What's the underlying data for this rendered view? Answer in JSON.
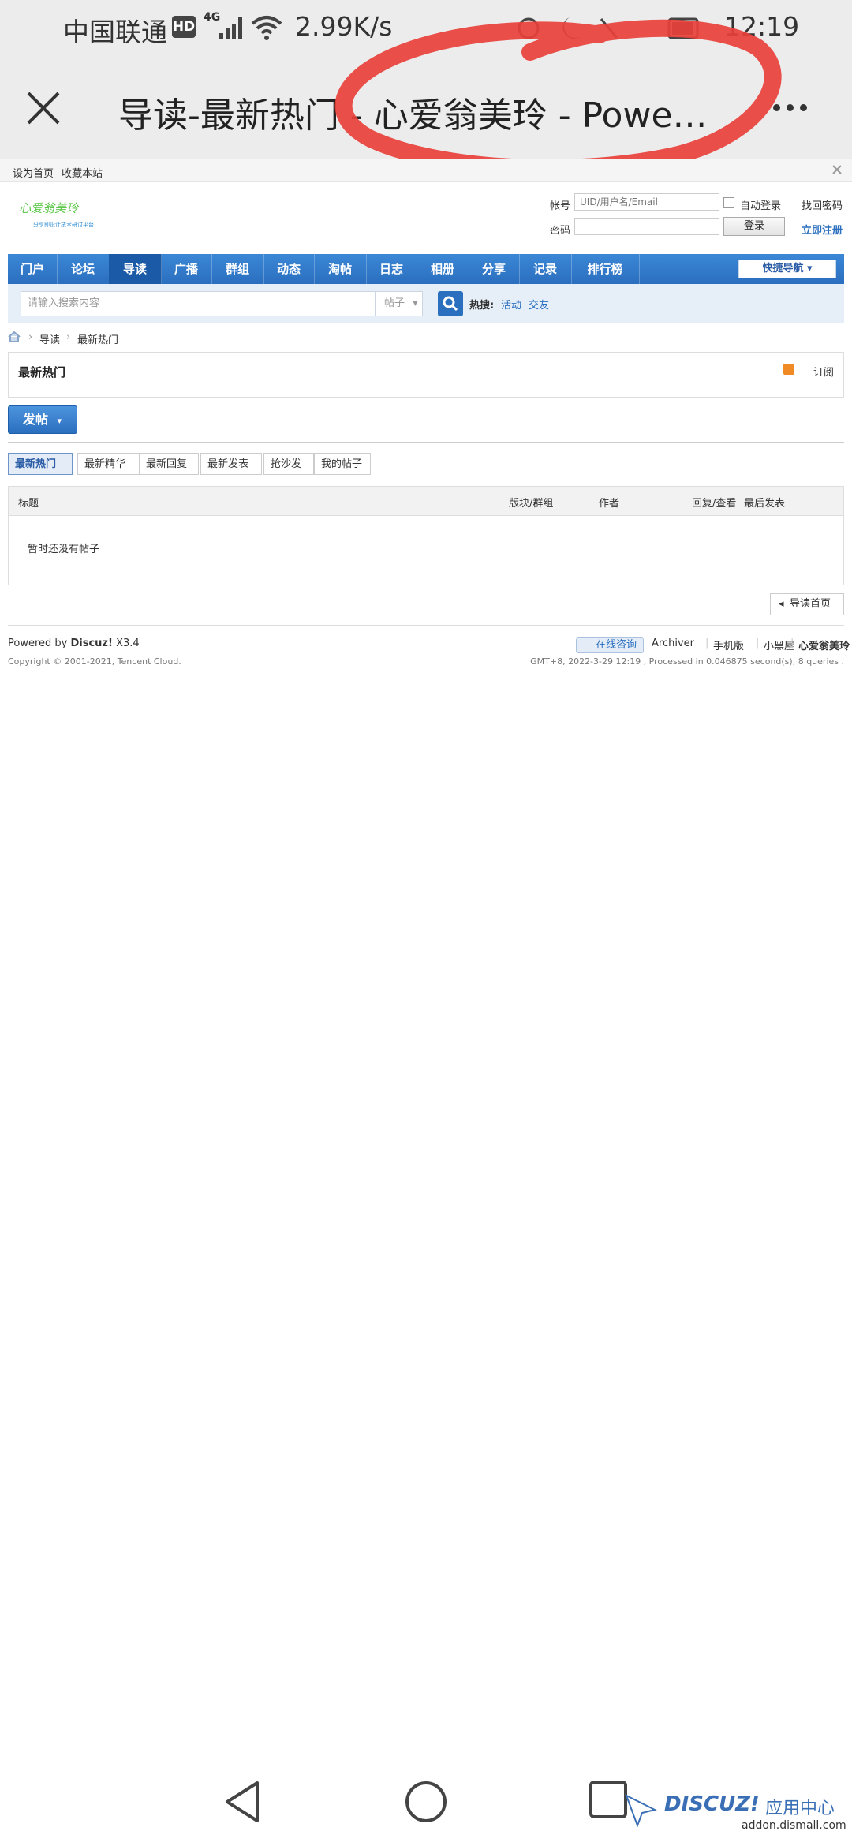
{
  "status_bar": {
    "carrier": "中国联通",
    "hd": "HD",
    "network": "4G",
    "speed": "2.99K/s",
    "time": "12:19"
  },
  "browser": {
    "title": "导读-最新热门 - 心爱翁美玲 - Powered by Discuz!"
  },
  "top_links": [
    "设为首页",
    "收藏本站"
  ],
  "header": {
    "logo_text": "心爱翁美玲",
    "logo_subtext": "分享即设计技术研讨平台",
    "login": {
      "account_label": "帐号",
      "account_placeholder": "UID/用户名/Email",
      "auto_login": "自动登录",
      "find_password": "找回密码",
      "password_label": "密码",
      "login_button": "登录",
      "register": "立即注册"
    }
  },
  "nav": {
    "items": [
      "门户",
      "论坛",
      "导读",
      "广播",
      "群组",
      "动态",
      "淘帖",
      "日志",
      "相册",
      "分享",
      "记录",
      "排行榜"
    ],
    "active_index": 2,
    "quick_nav": "快捷导航"
  },
  "search": {
    "placeholder": "请输入搜索内容",
    "type": "帖子",
    "hot_label": "热搜:",
    "hot_keywords": [
      "活动",
      "交友"
    ]
  },
  "breadcrumb": [
    "导读",
    "最新热门"
  ],
  "section": {
    "title": "最新热门",
    "subscribe": "订阅"
  },
  "post_button": "发帖",
  "tabs": {
    "items": [
      "最新热门",
      "最新精华",
      "最新回复",
      "最新发表",
      "抢沙发",
      "我的帖子"
    ],
    "active_index": 0
  },
  "table": {
    "columns": [
      "标题",
      "版块/群组",
      "作者",
      "回复/查看",
      "最后发表"
    ],
    "empty_message": "暂时还没有帖子"
  },
  "back_button": "导读首页",
  "footer": {
    "powered_prefix": "Powered by ",
    "powered_brand": "Discuz!",
    "powered_version": " X3.4",
    "copyright": "Copyright © 2001-2021, Tencent Cloud.",
    "consult": "在线咨询",
    "links": [
      "Archiver",
      "手机版",
      "小黑屋",
      "心爱翁美玲"
    ],
    "gmt": "GMT+8, 2022-3-29 12:19 , Processed in 0.046875 second(s), 8 queries ."
  },
  "watermark": {
    "brand": "DISCUZ!",
    "label": "应用中心",
    "url": "addon.dismall.com"
  },
  "colors": {
    "nav_blue": "#2b6fbf",
    "annotation_red": "#e8403a",
    "link_blue": "#2b6fbf"
  }
}
